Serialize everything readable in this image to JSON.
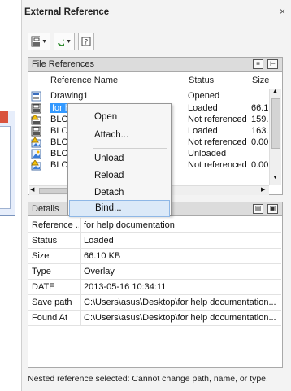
{
  "palette": {
    "title": "External Reference",
    "close_label": "×"
  },
  "file_references": {
    "header": "File References",
    "columns": {
      "name": "Reference Name",
      "status": "Status",
      "size": "Size"
    },
    "rows": [
      {
        "name": "Drawing1",
        "status": "Opened",
        "size": "",
        "icon": "drawing-icon"
      },
      {
        "name": "for help",
        "status": "Loaded",
        "size": "66.1",
        "icon": "dwg-icon"
      },
      {
        "name": "BLOCKS",
        "status": "Not referenced",
        "size": "159.",
        "icon": "dwg-warning-icon"
      },
      {
        "name": "BLOCKS",
        "status": "Loaded",
        "size": "163.",
        "icon": "dwg-icon"
      },
      {
        "name": "BLOCKS",
        "status": "Not referenced",
        "size": "0.00",
        "icon": "image-warning-icon"
      },
      {
        "name": "BLOCKS",
        "status": "Unloaded",
        "size": "",
        "icon": "image-icon"
      },
      {
        "name": "BLOCKS",
        "status": "Not referenced",
        "size": "0.00",
        "icon": "image-warning-icon"
      }
    ]
  },
  "context_menu": {
    "items": [
      "Open",
      "Attach...",
      "Unload",
      "Reload",
      "Detach",
      "Bind..."
    ],
    "highlighted": "Bind..."
  },
  "details": {
    "header": "Details",
    "rows": [
      {
        "key": "Reference ...",
        "value": "for help documentation"
      },
      {
        "key": "Status",
        "value": "Loaded"
      },
      {
        "key": "Size",
        "value": "66.10 KB"
      },
      {
        "key": "Type",
        "value": "Overlay"
      },
      {
        "key": "DATE",
        "value": "2013-05-16 10:34:11"
      },
      {
        "key": "Save path",
        "value": "C:\\Users\\asus\\Desktop\\for help documentation..."
      },
      {
        "key": "Found At",
        "value": "C:\\Users\\asus\\Desktop\\for help documentation..."
      }
    ]
  },
  "status_message": "Nested reference selected: Cannot change path, name, or type."
}
